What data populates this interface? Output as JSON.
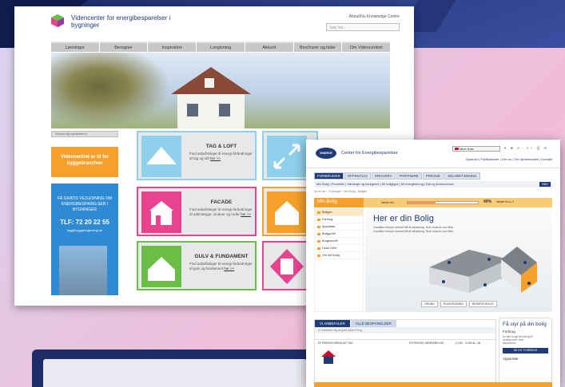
{
  "site1": {
    "brand": "Videncenter for energibesparelser i bygninger",
    "top_links": "About/Nu  Knowledge Centre",
    "search_placeholder": "Søg her...",
    "nav": [
      "Løsninger",
      "Beregner",
      "Inspiration",
      "Lovgivning",
      "Aktuelt",
      "Brochurer og lister",
      "Om Videncentret"
    ],
    "ad_strip": "Tilmeld dig nyhedsbrev",
    "orange_box": "Videncentret er til for byggebranchen",
    "blue_box": {
      "text": "FÅ GRATIS VEJLEDNING OM ENERGIBESPARELSER I BYGNINGER",
      "phone": "TLF: 72 20 22 55",
      "email": "byg@byggeriogenergi.dk"
    },
    "cards": [
      {
        "title": "TAG & LOFT",
        "text": "Find anbefalinger til energi-forbedringer af tag og loft",
        "link": "her >>"
      },
      {
        "title": "FACADE",
        "text": "Find anbefalinger til energi-forbedringer af ydervægge, vinduer og ruder",
        "link": "her >>"
      },
      {
        "title": "GULV & FUNDAMENT",
        "text": "Find anbefalinger til energi-forbedringer af gulv og fundament",
        "link": "her >>"
      }
    ]
  },
  "site2": {
    "logo": "ENERGI",
    "brand": "Center for Energibesparelser",
    "language_select": "Mine links",
    "tools": "▾ ⊕ A- A+ ⎙ ✉",
    "top_links": "Nyheder | Publikationer | Om os | Om hjemmesiden | Kontakt",
    "nav": [
      "FORBRUGER",
      "OFFENTLIG",
      "ERHVERV",
      "PARTNERE",
      "PRESSE",
      "SELVBETJENING"
    ],
    "subnav": "Min Bolig  |  Produkter  |  Værktøjer og beregnere  |  Dit boligtype  |  Dit energiforbrug  |  Spil og konkurrencer",
    "subnav_go": "SØG",
    "breadcrumb": "Du er her: › Forbruger › Min Bolig › Boligen",
    "section_title": "Min Bolig",
    "next_step": "Næste trin",
    "progress_value": 0.4,
    "progress_label": "40%",
    "step_label": "Næste trin ▸ 2",
    "sidebar": [
      "Boligen",
      "Forbrug",
      "Apparater",
      "Boligprofil",
      "Brugerprofil",
      "Hvad 1000",
      "Om din Bolig"
    ],
    "main_title": "Her er din Bolig",
    "main_text": "Curabitur tempor laoreet elit at adipiscing. Duis ut lacus non felis. Curabitur tempor laoreet elit at adipiscing. Duis ut lacus non felis.",
    "view_buttons": [
      "GRUND",
      "PLANTEGNING",
      "BESKRIV BOLIG"
    ],
    "bottom_tabs": [
      "VI ANBEFALER",
      "ALLE BESPARELSER"
    ],
    "bottom_info": "Vi anbefaler dig at gøre disse 5 ting",
    "bottom_row": {
      "col1": "EFTERISOLERING AF TAG",
      "col2": "POTENTIEL BESPARELSE",
      "col3": "2.100 - 3.400 kr. / år"
    },
    "right_title": "Få styr på din bolig",
    "right_sub": "Forbrug",
    "right_text": "Du kan bruge dit forbrug til at følge med i dine besparelser",
    "right_button": "SE DIT FORBRUG",
    "right_sub2": "Apparater"
  },
  "colors": {
    "navy": "#1e3c78",
    "orange": "#f4a02a",
    "pink": "#e9428f",
    "green": "#6abd45",
    "sky": "#8fd0ec",
    "blue": "#2e8ad2"
  }
}
